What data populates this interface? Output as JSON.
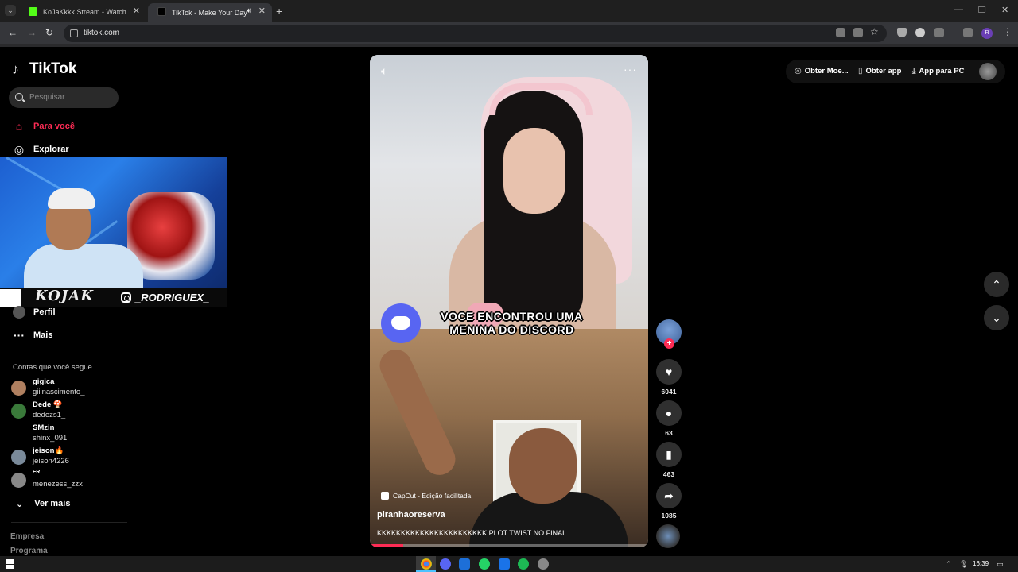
{
  "browser": {
    "tabs": [
      {
        "label": "KoJaKkkk Stream - Watch Live o"
      },
      {
        "label": "TikTok - Make Your Day"
      }
    ],
    "url": "tiktok.com"
  },
  "sidebar": {
    "logo": "TikTok",
    "search_placeholder": "Pesquisar",
    "nav": {
      "for_you": "Para você",
      "explore": "Explorar",
      "profile": "Perfil",
      "more": "Mais"
    },
    "following_title": "Contas que você segue",
    "accounts": [
      {
        "name": "gigica",
        "username": "giiinascimento_",
        "color": "#b08060"
      },
      {
        "name": "Dede 🍄",
        "username": "dedezs1_",
        "color": "#3a7a3a"
      },
      {
        "name": "SMzin",
        "username": "shinx_091",
        "color": "#000000"
      },
      {
        "name": "jeison🔥",
        "username": "jeison4226",
        "color": "#7a8a9a"
      },
      {
        "name": "FR",
        "username": "menezess_zzx",
        "color": "#888888"
      }
    ],
    "see_more": "Ver mais",
    "footer": [
      "Empresa",
      "Programa"
    ]
  },
  "stream_overlay": {
    "script_text": "KOJAK",
    "handle": "_RODRIGUEX_"
  },
  "video": {
    "overlay_text": "VOCE ENCONTROU UMA MENINA DO DISCORD",
    "capcut_label": "CapCut - Edição facilitada",
    "author": "piranhaoreserva",
    "description": "KKKKKKKKKKKKKKKKKKKKKKK PLOT TWIST NO FINAL",
    "progress": 0.12
  },
  "actions": {
    "likes": "6041",
    "comments": "63",
    "saves": "463",
    "shares": "1085"
  },
  "top_right": {
    "coins": "Obter Moe...",
    "get_app": "Obter app",
    "pc_app": "App para PC"
  },
  "taskbar": {
    "time": "16:39"
  },
  "colors": {
    "accent": "#fe2c55",
    "background": "#000000"
  }
}
